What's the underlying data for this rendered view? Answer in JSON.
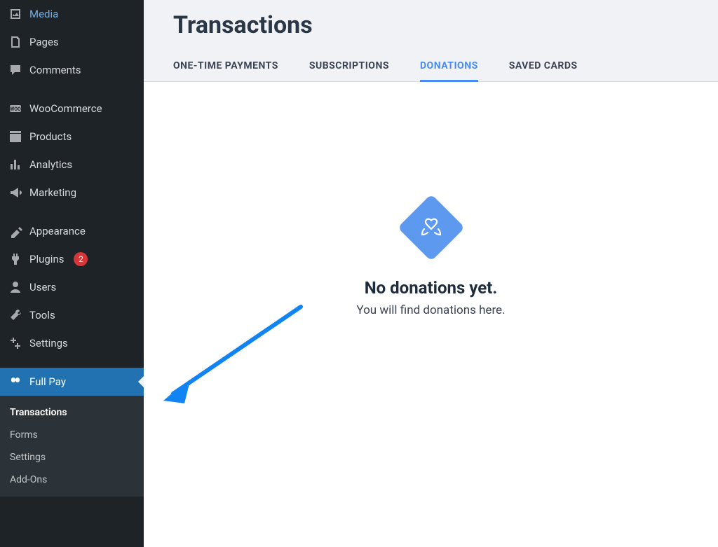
{
  "sidebar": {
    "items": [
      {
        "label": "Media",
        "icon": "media"
      },
      {
        "label": "Pages",
        "icon": "pages"
      },
      {
        "label": "Comments",
        "icon": "comments"
      },
      {
        "spacer": true
      },
      {
        "label": "WooCommerce",
        "icon": "woo"
      },
      {
        "label": "Products",
        "icon": "products"
      },
      {
        "label": "Analytics",
        "icon": "analytics"
      },
      {
        "label": "Marketing",
        "icon": "marketing"
      },
      {
        "spacer": true
      },
      {
        "label": "Appearance",
        "icon": "appearance"
      },
      {
        "label": "Plugins",
        "icon": "plugins",
        "badge": "2"
      },
      {
        "label": "Users",
        "icon": "users"
      },
      {
        "label": "Tools",
        "icon": "tools"
      },
      {
        "label": "Settings",
        "icon": "settings"
      },
      {
        "spacer": true
      },
      {
        "label": "Full Pay",
        "icon": "fullpay",
        "active": true
      }
    ],
    "submenu": [
      {
        "label": "Transactions",
        "active": true
      },
      {
        "label": "Forms"
      },
      {
        "label": "Settings"
      },
      {
        "label": "Add-Ons"
      }
    ]
  },
  "page": {
    "title": "Transactions"
  },
  "tabs": [
    {
      "label": "ONE-TIME PAYMENTS"
    },
    {
      "label": "SUBSCRIPTIONS"
    },
    {
      "label": "DONATIONS",
      "active": true
    },
    {
      "label": "SAVED CARDS"
    }
  ],
  "empty": {
    "title": "No donations yet.",
    "subtitle": "You will find donations here."
  }
}
